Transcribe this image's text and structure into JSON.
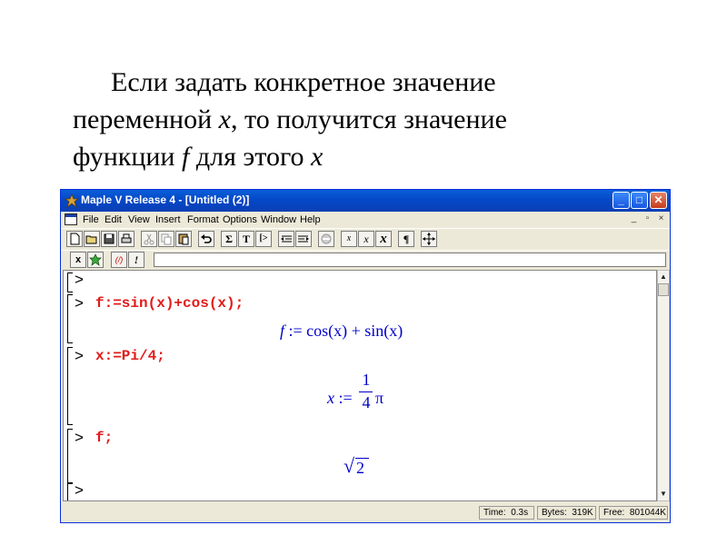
{
  "caption": {
    "line1": "Если задать конкретное значение",
    "line2_pre": "переменной ",
    "line2_var": "x",
    "line2_post": ", то получится значение",
    "line3_pre": "функции ",
    "line3_var": "f",
    "line3_mid": " для этого ",
    "line3_var2": "x"
  },
  "window": {
    "title": "Maple V Release 4 - [Untitled (2)]",
    "controls": {
      "minimize": "_",
      "maximize": "□",
      "close": "✕"
    }
  },
  "menu": {
    "items": [
      "File",
      "Edit",
      "View",
      "Insert",
      "Format",
      "Options",
      "Window",
      "Help"
    ],
    "mdi_controls": [
      "_",
      "▫",
      "×"
    ]
  },
  "toolbar": {
    "text_buttons": {
      "sigma": "Σ",
      "text": "T",
      "exec": "[>",
      "x1": "x",
      "x2": "x",
      "x3": "x",
      "para": "¶"
    }
  },
  "context_bar": {
    "x_button": "x",
    "div_button": "(/)",
    "exclaim_button": "!"
  },
  "worksheet": {
    "prompt": ">",
    "inputs": [
      "f:=sin(x)+cos(x);",
      "x:=Pi/4;",
      "f;"
    ],
    "output1": {
      "lhs": "f",
      "assign": " := ",
      "rhs": "cos(x) + sin(x)"
    },
    "output2": {
      "lhs": "x",
      "assign": " := ",
      "num": "1",
      "den": "4",
      "pi": "π"
    },
    "output3": {
      "sqrt": "√",
      "radicand": "2"
    }
  },
  "status": {
    "time_label": "Time:",
    "time_value": "0.3s",
    "bytes_label": "Bytes:",
    "bytes_value": "319K",
    "free_label": "Free:",
    "free_value": "801044K"
  }
}
